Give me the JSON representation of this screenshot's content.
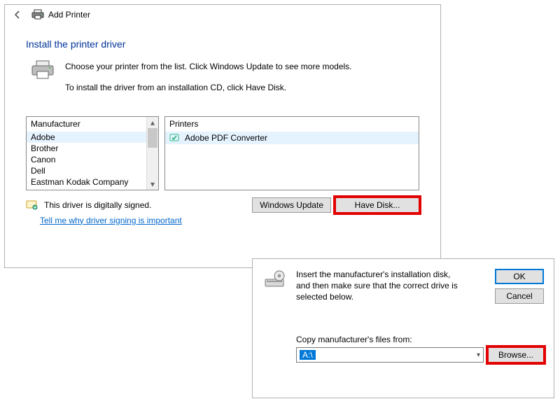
{
  "header": {
    "title": "Add Printer"
  },
  "page": {
    "heading": "Install the printer driver",
    "line1": "Choose your printer from the list. Click Windows Update to see more models.",
    "line2": "To install the driver from an installation CD, click Have Disk."
  },
  "manufacturer": {
    "header": "Manufacturer",
    "items": [
      "Adobe",
      "Brother",
      "Canon",
      "Dell",
      "Eastman Kodak Company"
    ],
    "selected": 0
  },
  "printers": {
    "header": "Printers",
    "item": "Adobe PDF Converter"
  },
  "signature": {
    "text": "This driver is digitally signed.",
    "link": "Tell me why driver signing is important"
  },
  "buttons": {
    "windows_update": "Windows Update",
    "have_disk": "Have Disk..."
  },
  "subdialog": {
    "instruction": "Insert the manufacturer's installation disk, and then make sure that the correct drive is selected below.",
    "ok": "OK",
    "cancel": "Cancel",
    "copy_label": "Copy manufacturer's files from:",
    "drive_value": "A:\\",
    "browse": "Browse..."
  }
}
